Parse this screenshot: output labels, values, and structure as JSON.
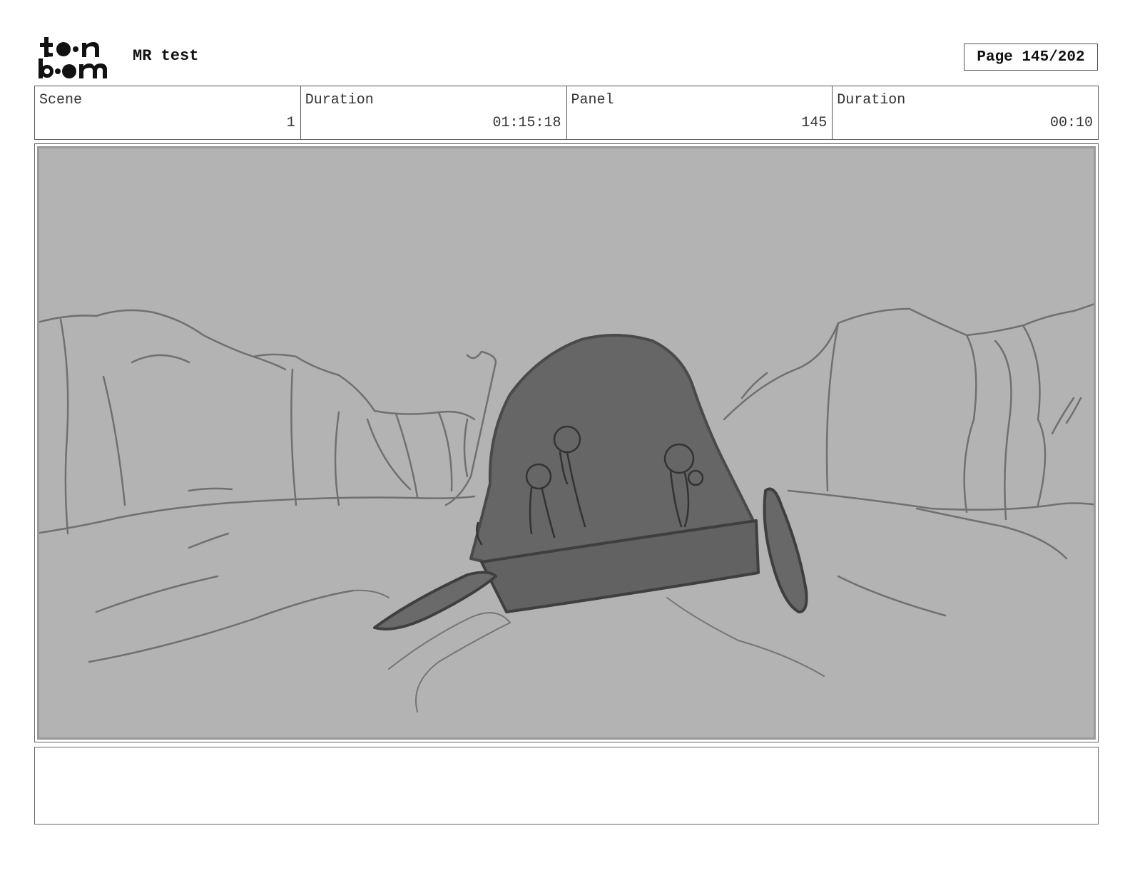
{
  "header": {
    "logo_text": "toon boom",
    "project_title": "MR test",
    "page_label": "Page 145/202"
  },
  "info": {
    "scene_label": "Scene",
    "scene_value": "1",
    "scene_duration_label": "Duration",
    "scene_duration_value": "01:15:18",
    "panel_label": "Panel",
    "panel_value": "145",
    "panel_duration_label": "Duration",
    "panel_duration_value": "00:10"
  },
  "panel": {
    "background_color": "#b3b3b3",
    "sketch_line_color": "#6f6f6f",
    "vehicle_fill_color": "#666666"
  },
  "notes": {
    "text": ""
  }
}
